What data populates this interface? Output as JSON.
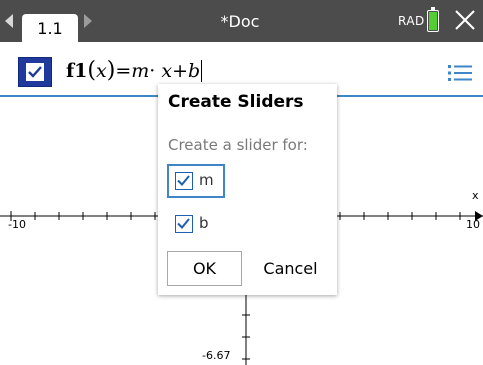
{
  "topbar": {
    "tab_label": "1.1",
    "doc_title": "*Doc",
    "angle_mode": "RAD"
  },
  "entry": {
    "func_name": "f1",
    "arg": "x",
    "equals": "=",
    "rhs_m": "m",
    "dot": "·",
    "rhs_x": "x",
    "plus": "+",
    "rhs_b": "b",
    "checked": true
  },
  "graph": {
    "x_min_label": "-10",
    "x_max_label": "10",
    "x_axis_name": "x",
    "y_min_label": "-6.67"
  },
  "dialog": {
    "title": "Create Sliders",
    "subtitle": "Create a slider for:",
    "options": [
      {
        "label": "m",
        "checked": true
      },
      {
        "label": "b",
        "checked": true
      }
    ],
    "ok_label": "OK",
    "cancel_label": "Cancel"
  },
  "colors": {
    "topbar": "#4c4c4c",
    "accent_blue": "#3f86c8",
    "checkbox_blue": "#1f3a9c",
    "battery_green": "#55cc33"
  }
}
